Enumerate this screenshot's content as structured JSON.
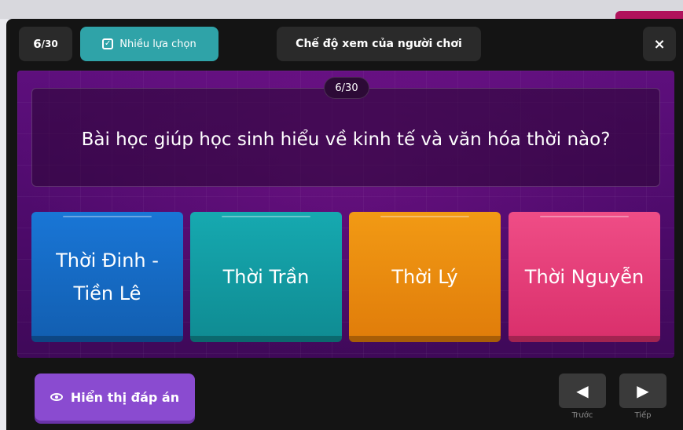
{
  "header": {
    "question_count": "6",
    "question_total": "/30",
    "question_type": "Nhiều lựa chọn",
    "mode": "Chế độ xem của người chơi",
    "close_label": "×"
  },
  "question": {
    "progress": "6/30",
    "text": "Bài học giúp học sinh hiểu về kinh tế và văn hóa thời nào?"
  },
  "answers": [
    {
      "label": "Thời Đinh - Tiền Lê",
      "color": "#1976d6"
    },
    {
      "label": "Thời Trần",
      "color": "#16a9b0"
    },
    {
      "label": "Thời Lý",
      "color": "#f29a14"
    },
    {
      "label": "Thời Nguyễn",
      "color": "#ef4d86"
    }
  ],
  "footer": {
    "reveal_label": "Hiển thị đáp án",
    "prev_label": "Trước",
    "next_label": "Tiếp"
  },
  "colors": {
    "stage": "#5e0f7d",
    "reveal_button": "#8a4bd0",
    "type_pill": "#2fa3a8"
  }
}
